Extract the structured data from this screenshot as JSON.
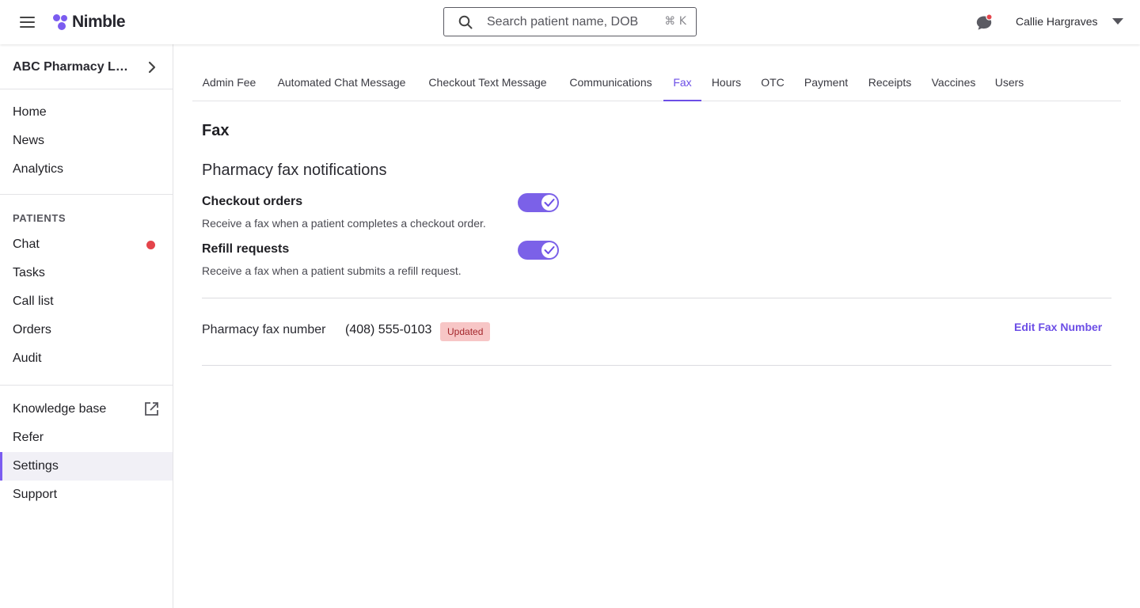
{
  "header": {
    "brand": "Nimble",
    "search_placeholder": "Search patient name, DOB",
    "search_shortcut": "⌘ K",
    "user_name": "Callie Hargraves",
    "accent_color": "#7b5cf0",
    "notification_color": "#e4444b"
  },
  "sidebar": {
    "store_name": "ABC Pharmacy Loc...",
    "main_items": [
      "Home",
      "News",
      "Analytics"
    ],
    "patients_header": "PATIENTS",
    "patient_items": [
      "Chat",
      "Tasks",
      "Call list",
      "Orders",
      "Audit"
    ],
    "chat_has_unread": true,
    "footer_items": [
      "Knowledge base",
      "Refer",
      "Settings",
      "Support"
    ],
    "active_item": "Settings"
  },
  "tabs": [
    "Admin Fee",
    "Automated Chat Message",
    "Checkout Text Message",
    "Communications",
    "Fax",
    "Hours",
    "OTC",
    "Payment",
    "Receipts",
    "Vaccines",
    "Users"
  ],
  "active_tab": "Fax",
  "page": {
    "title": "Fax",
    "section_title": "Pharmacy fax notifications",
    "settings": [
      {
        "label": "Checkout orders",
        "description": "Receive a fax when a patient completes a checkout order.",
        "enabled": true
      },
      {
        "label": "Refill requests",
        "description": "Receive a fax when a patient submits a refill request.",
        "enabled": true
      }
    ],
    "fax_label": "Pharmacy fax number",
    "fax_number": "(408) 555-0103",
    "fax_badge": "Updated",
    "edit_link": "Edit Fax Number"
  }
}
